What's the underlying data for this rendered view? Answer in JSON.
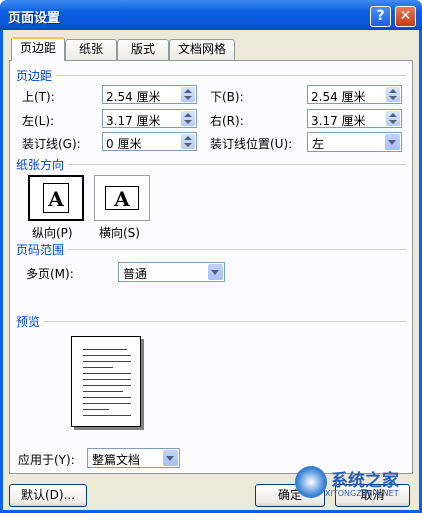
{
  "window": {
    "title": "页面设置",
    "help_glyph": "?",
    "close_glyph": "✕"
  },
  "tabs": [
    {
      "label": "页边距",
      "active": true
    },
    {
      "label": "纸张"
    },
    {
      "label": "版式"
    },
    {
      "label": "文档网格"
    }
  ],
  "margins": {
    "section_title": "页边距",
    "top_label": "上(T):",
    "top_value": "2.54 厘米",
    "bottom_label": "下(B):",
    "bottom_value": "2.54 厘米",
    "left_label": "左(L):",
    "left_value": "3.17 厘米",
    "right_label": "右(R):",
    "right_value": "3.17 厘米",
    "gutter_label": "装订线(G):",
    "gutter_value": "0 厘米",
    "gutter_pos_label": "装订线位置(U):",
    "gutter_pos_value": "左"
  },
  "orientation": {
    "section_title": "纸张方向",
    "portrait_label": "纵向(P)",
    "landscape_label": "横向(S)",
    "glyph": "A",
    "selected": "portrait"
  },
  "pages": {
    "section_title": "页码范围",
    "multi_label": "多页(M):",
    "multi_value": "普通"
  },
  "preview": {
    "section_title": "预览",
    "apply_label": "应用于(Y):",
    "apply_value": "整篇文档"
  },
  "buttons": {
    "default": "默认(D)...",
    "ok": "确定",
    "cancel": "取消"
  },
  "watermark": {
    "main": "系统之家",
    "sub": "XITONGZHIJIA.NET"
  },
  "colors": {
    "title_bar": "#0b5de0",
    "section_title": "#0046d5",
    "dialog_bg": "#ece9d8"
  }
}
